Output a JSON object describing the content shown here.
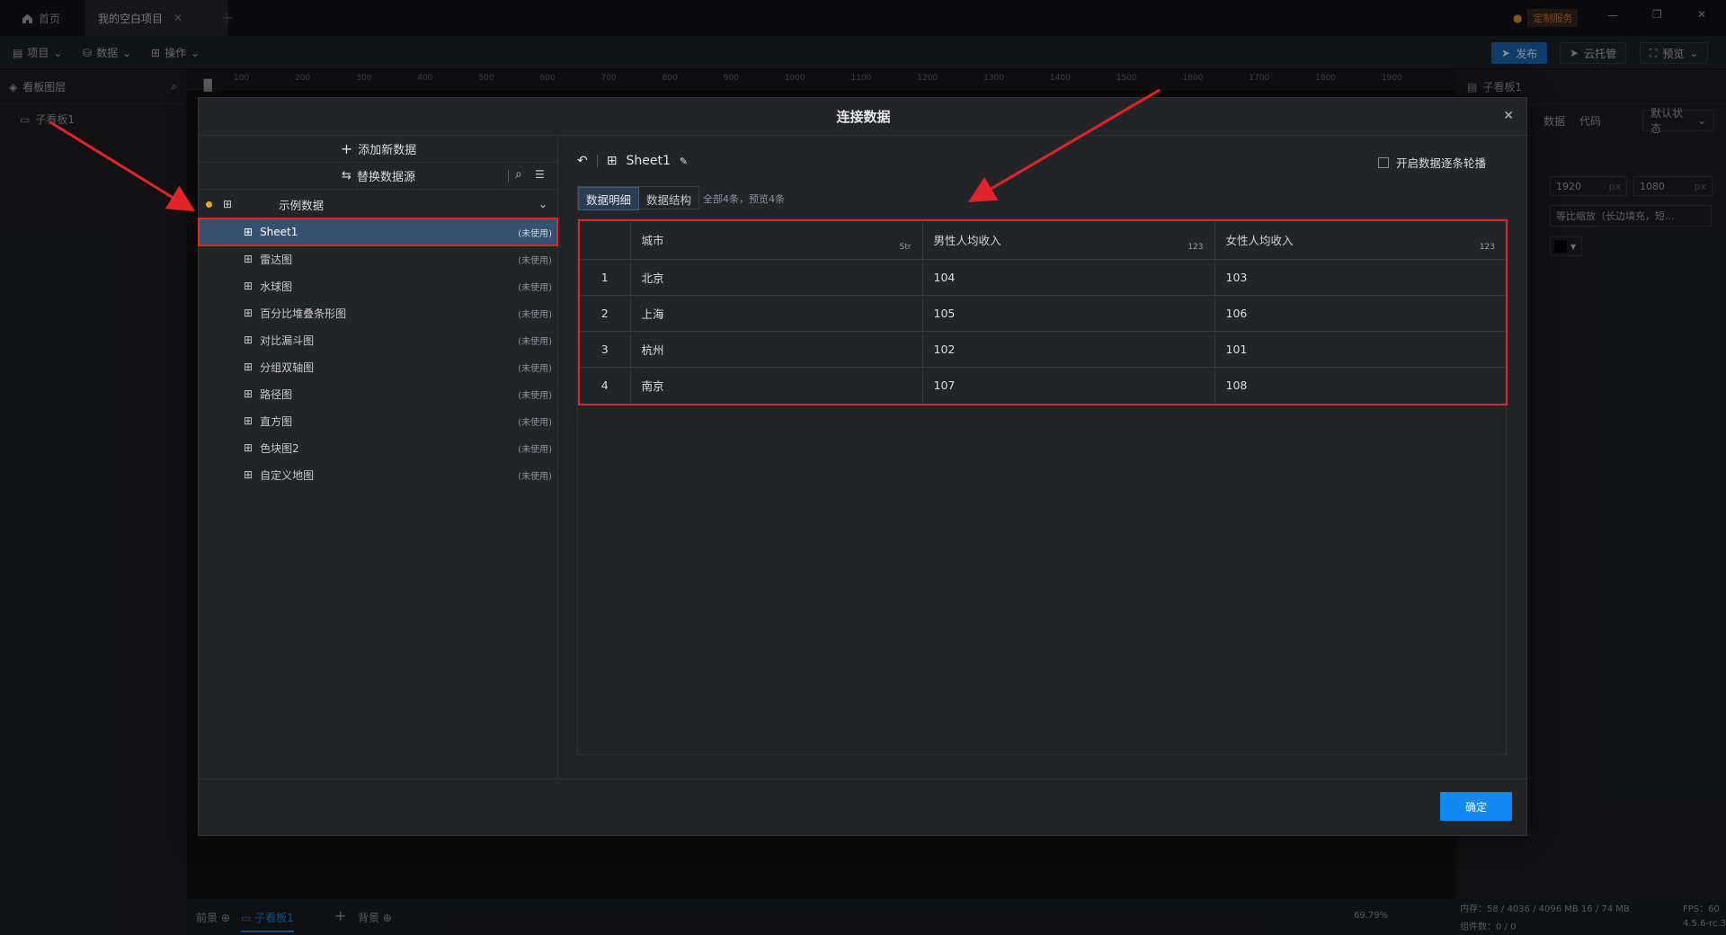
{
  "tabs": {
    "home": "首页",
    "project": "我的空白项目"
  },
  "header_right": {
    "custom_service": "定制服务"
  },
  "menus": {
    "project": "项目",
    "data": "数据",
    "ops": "操作"
  },
  "toolbar": {
    "publish": "发布",
    "cloud": "云托管",
    "preview": "预览"
  },
  "left_panel": {
    "title": "看板图层",
    "item": "子看板1"
  },
  "ruler": {
    "ticks": [
      "100",
      "200",
      "300",
      "400",
      "500",
      "600",
      "700",
      "800",
      "900",
      "1000",
      "1100",
      "1200",
      "1300",
      "1400",
      "1500",
      "1600",
      "1700",
      "1800",
      "1900"
    ]
  },
  "right_panel": {
    "title": "子看板1",
    "tabs": [
      "数据",
      "代码"
    ],
    "state": "默认状态",
    "width": "1920",
    "height": "1080",
    "unit": "px",
    "scale": "等比缩放（长边填充，短..."
  },
  "bottom": {
    "front": "前景",
    "board": "子看板1",
    "back": "背景",
    "zoom": "69.79%",
    "memory": "内存：58 / 4036 / 4096 MB  16 / 74 MB",
    "fps": "FPS：60",
    "components": "组件数：0 / 0",
    "version": "4.5.6-rc.3"
  },
  "modal": {
    "title": "连接数据",
    "add_data": "添加新数据",
    "replace_source": "替换数据源",
    "group": "示例数据",
    "items": [
      {
        "name": "Sheet1",
        "status": "(未使用)"
      },
      {
        "name": "雷达图",
        "status": "(未使用)"
      },
      {
        "name": "水球图",
        "status": "(未使用)"
      },
      {
        "name": "百分比堆叠条形图",
        "status": "(未使用)"
      },
      {
        "name": "对比漏斗图",
        "status": "(未使用)"
      },
      {
        "name": "分组双轴图",
        "status": "(未使用)"
      },
      {
        "name": "路径图",
        "status": "(未使用)"
      },
      {
        "name": "直方图",
        "status": "(未使用)"
      },
      {
        "name": "色块图2",
        "status": "(未使用)"
      },
      {
        "name": "自定义地图",
        "status": "(未使用)"
      }
    ],
    "sheet_title": "Sheet1",
    "carousel": "开启数据逐条轮播",
    "subtabs": [
      "数据明细",
      "数据结构"
    ],
    "summary": "全部4条，预览4条",
    "columns": [
      {
        "name": "城市",
        "type": "Str"
      },
      {
        "name": "男性人均收入",
        "type": "123"
      },
      {
        "name": "女性人均收入",
        "type": "123"
      }
    ],
    "rows": [
      [
        "1",
        "北京",
        "104",
        "103"
      ],
      [
        "2",
        "上海",
        "105",
        "106"
      ],
      [
        "3",
        "杭州",
        "102",
        "101"
      ],
      [
        "4",
        "南京",
        "107",
        "108"
      ]
    ],
    "confirm": "确定"
  },
  "colors": {
    "accent": "#1189f5",
    "highlight": "#e0242a",
    "selected": "#36516f"
  }
}
